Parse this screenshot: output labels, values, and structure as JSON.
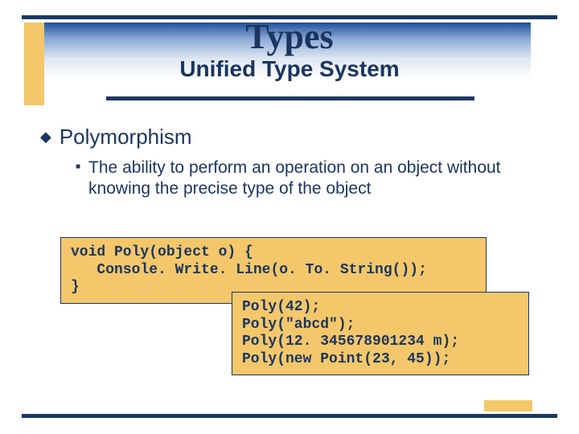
{
  "title": "Types",
  "subtitle": "Unified Type System",
  "bullets": {
    "l1": "Polymorphism",
    "l2": "The ability to perform an operation on an object without knowing the precise type of the object"
  },
  "code1": "void Poly(object o) {\n   Console. Write. Line(o. To. String());\n}",
  "code2": "Poly(42);\nPoly(\"abcd\");\nPoly(12. 345678901234 m);\nPoly(new Point(23, 45));"
}
